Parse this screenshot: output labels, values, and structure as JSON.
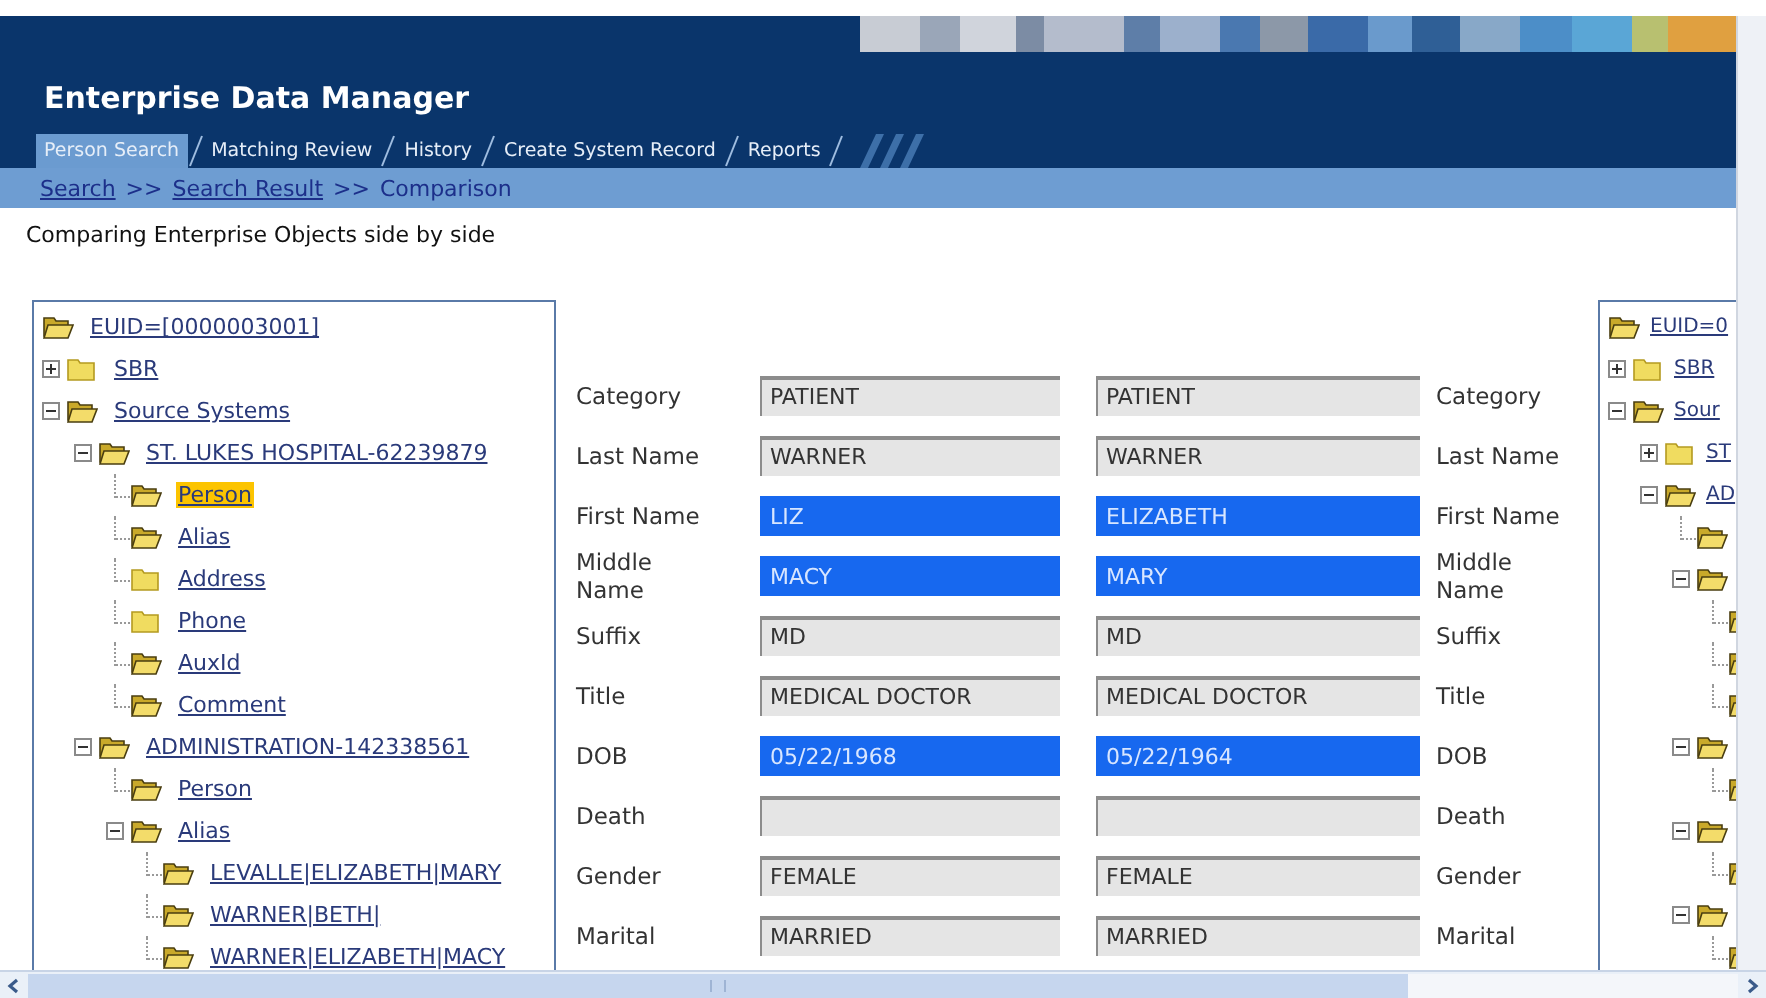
{
  "app_title": "Enterprise Data Manager",
  "tabs": [
    {
      "label": "Person Search",
      "selected": true
    },
    {
      "label": "Matching Review",
      "selected": false
    },
    {
      "label": "History",
      "selected": false
    },
    {
      "label": "Create System Record",
      "selected": false
    },
    {
      "label": "Reports",
      "selected": false
    }
  ],
  "breadcrumb": [
    {
      "kind": "link",
      "text": "Search"
    },
    {
      "kind": "separator",
      "text": ">>"
    },
    {
      "kind": "link",
      "text": "Search Result"
    },
    {
      "kind": "separator",
      "text": ">>"
    },
    {
      "kind": "current",
      "text": "Comparison"
    }
  ],
  "description": "Comparing Enterprise Objects side by side",
  "left_tree": {
    "label": "EUID=[0000003001]",
    "folder_open": true,
    "selected": false,
    "children": [
      {
        "label": "SBR",
        "expanded": false,
        "folder_open": false,
        "selected": false
      },
      {
        "label": "Source Systems",
        "expanded": true,
        "folder_open": true,
        "selected": false,
        "children": [
          {
            "label": "ST. LUKES HOSPITAL-62239879",
            "expanded": true,
            "folder_open": true,
            "selected": false,
            "children": [
              {
                "label": "Person",
                "folder_open": true,
                "selected": true
              },
              {
                "label": "Alias",
                "folder_open": true,
                "selected": false
              },
              {
                "label": "Address",
                "folder_open": false,
                "selected": false
              },
              {
                "label": "Phone",
                "folder_open": false,
                "selected": false
              },
              {
                "label": "AuxId",
                "folder_open": true,
                "selected": false
              },
              {
                "label": "Comment",
                "folder_open": true,
                "selected": false
              }
            ]
          },
          {
            "label": "ADMINISTRATION-142338561",
            "expanded": true,
            "folder_open": true,
            "selected": false,
            "children": [
              {
                "label": "Person",
                "folder_open": true,
                "selected": false
              },
              {
                "label": "Alias",
                "expanded": true,
                "folder_open": true,
                "selected": false,
                "children": [
                  {
                    "label": "LEVALLE|ELIZABETH|MARY",
                    "folder_open": true,
                    "selected": false
                  },
                  {
                    "label": "WARNER|BETH|",
                    "folder_open": true,
                    "selected": false
                  },
                  {
                    "label": "WARNER|ELIZABETH|MACY",
                    "folder_open": true,
                    "selected": false
                  }
                ]
              }
            ]
          }
        ]
      }
    ]
  },
  "comparison_rows": [
    {
      "label": "Category",
      "value_a": "PATIENT",
      "value_b": "PATIENT",
      "label_b": "Category",
      "highlighted": false
    },
    {
      "label": "Last Name",
      "value_a": "WARNER",
      "value_b": "WARNER",
      "label_b": "Last Name",
      "highlighted": false
    },
    {
      "label": "First Name",
      "value_a": "LIZ",
      "value_b": "ELIZABETH",
      "label_b": "First Name",
      "highlighted": true
    },
    {
      "label": "Middle Name",
      "value_a": "MACY",
      "value_b": "MARY",
      "label_b": "Middle Name",
      "highlighted": true
    },
    {
      "label": "Suffix",
      "value_a": "MD",
      "value_b": "MD",
      "label_b": "Suffix",
      "highlighted": false
    },
    {
      "label": "Title",
      "value_a": "MEDICAL DOCTOR",
      "value_b": "MEDICAL DOCTOR",
      "label_b": "Title",
      "highlighted": false
    },
    {
      "label": "DOB",
      "value_a": "05/22/1968",
      "value_b": "05/22/1964",
      "label_b": "DOB",
      "highlighted": true
    },
    {
      "label": "Death",
      "label_b": "Death",
      "highlighted": false
    },
    {
      "label": "Gender",
      "value_a": "FEMALE",
      "value_b": "FEMALE",
      "label_b": "Gender",
      "highlighted": false
    },
    {
      "label": "Marital",
      "value_a": "MARRIED",
      "value_b": "MARRIED",
      "label_b": "Marital",
      "highlighted": false
    }
  ],
  "right_tree": {
    "label": "EUID=0",
    "folder_open": true,
    "selected": false,
    "children": [
      {
        "label": "SBR",
        "expanded": false,
        "folder_open": false,
        "selected": false
      },
      {
        "label": "Sour",
        "expanded": true,
        "folder_open": true,
        "selected": false,
        "children": [
          {
            "label": "ST",
            "expanded": false,
            "folder_open": false,
            "selected": false
          },
          {
            "label": "AD",
            "expanded": true,
            "folder_open": true,
            "selected": false,
            "children": [
              {
                "folder_open": true,
                "selected": false
              },
              {
                "expanded": true,
                "folder_open": true,
                "selected": false,
                "children": [
                  {
                    "folder_open": true,
                    "selected": false
                  },
                  {
                    "folder_open": true,
                    "selected": false
                  },
                  {
                    "folder_open": true,
                    "selected": false
                  }
                ]
              },
              {
                "expanded": true,
                "folder_open": true,
                "selected": false,
                "children": [
                  {
                    "folder_open": true,
                    "selected": false
                  }
                ]
              },
              {
                "expanded": true,
                "folder_open": true,
                "selected": false,
                "children": [
                  {
                    "folder_open": true,
                    "selected": false
                  }
                ]
              },
              {
                "expanded": true,
                "folder_open": true,
                "selected": false,
                "children": [
                  {
                    "folder_open": true,
                    "selected": false
                  }
                ]
              }
            ]
          }
        ]
      }
    ]
  }
}
